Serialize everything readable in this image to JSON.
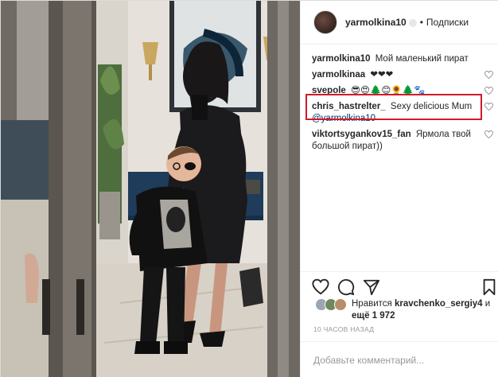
{
  "post": {
    "username": "yarmolkina10",
    "separator": "•",
    "follow_label": "Подписки"
  },
  "comments": [
    {
      "user": "yarmolkina10",
      "text": "Мой маленький пират"
    },
    {
      "user": "yarmolkinaa",
      "text": "❤❤❤"
    },
    {
      "user": "svepole",
      "text": "😎😍🌲😊🌻🌲🐾"
    },
    {
      "user": "chris_hastrelter_",
      "text": "Sexy delicious Mum",
      "mention": "@yarmolkina10"
    },
    {
      "user": "viktortsygankov15_fan",
      "text": "Ярмола твой большой пират))"
    }
  ],
  "likes": {
    "prefix": "Нравится",
    "user": "kravchenko_sergiy4",
    "middle": "и",
    "count_text": "ещё 1 972"
  },
  "time_label": "10 ЧАСОВ НАЗАД",
  "add_comment_placeholder": "Добавьте комментарий...",
  "icons": [
    "heart-icon",
    "comment-icon",
    "share-icon",
    "bookmark-icon",
    "verified-icon"
  ],
  "colors": {
    "highlight": "#d11a2a",
    "link": "#003569",
    "muted": "#999999",
    "text": "#262626"
  }
}
